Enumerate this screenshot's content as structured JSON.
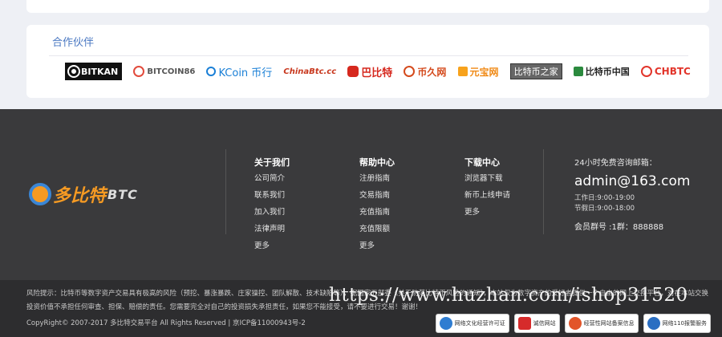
{
  "partners": {
    "title": "合作伙伴",
    "logos": [
      {
        "icon": "bitkan-logo-icon",
        "text": "BITKAN"
      },
      {
        "icon": "bitcoin86-logo-icon",
        "text": "BITCOIN86"
      },
      {
        "icon": "okcoin-logo-icon",
        "text": "KCoin 币行"
      },
      {
        "icon": "chinabtc-logo-icon",
        "text": "ChinaBtc.cc"
      },
      {
        "icon": "8btc-logo-icon",
        "text": "巴比特"
      },
      {
        "icon": "btcdo-logo-icon",
        "text": "币久网"
      },
      {
        "icon": "yuanbao-logo-icon",
        "text": "元宝网"
      },
      {
        "icon": "btczj-logo-icon",
        "text": "比特币之家"
      },
      {
        "icon": "btcchina-logo-icon",
        "text": "比特币中国"
      },
      {
        "icon": "chbtc-logo-icon",
        "text": "CHBTC"
      }
    ]
  },
  "footer": {
    "brand": {
      "name": "多比特",
      "suffix": "BTC"
    },
    "columns": [
      {
        "title": "关于我们",
        "links": [
          "公司简介",
          "联系我们",
          "加入我们",
          "法律声明",
          "更多"
        ]
      },
      {
        "title": "帮助中心",
        "links": [
          "注册指南",
          "交易指南",
          "充值指南",
          "充值限额",
          "更多"
        ]
      },
      {
        "title": "下载中心",
        "links": [
          "浏览器下载",
          "新币上线申请",
          "更多"
        ]
      }
    ],
    "contact": {
      "label": "24小时免费咨询邮箱：",
      "email": "admin@163.com",
      "workday": "工作日:9:00-19:00",
      "holiday": "节假日:9:00-18:00",
      "qq": "会员群号 :1群：888888"
    }
  },
  "bottom": {
    "risk_line1": "风险提示：比特币等数字资产交易具有极高的风险（预挖、暴涨暴跌、庄家操控、团队解散、技术缺陷等），据国家五部委《关于防范比特币风险的通知》，本站仅为数字资产的爱好者提供一个自由的网上交换平台，对在本站交换的数字资产的来源、价值，网站运营方不承担任何审查、担保、赔偿的责任",
    "risk_line2": "投资价值不承担任何审查、担保、赔偿的责任。您需要完全对自己的投资损失承担责任，如果您不能接受，请不要进行交易！谢谢！",
    "copyright": "CopyRight© 2007-2017 多比特交易平台 All Rights Reserved  |  京ICP备11000943号-2",
    "watermark": "https://www.huzhan.com/ishop31520",
    "badges": [
      "网络文化经营许可证",
      "诚信网站",
      "经营性网站备案信息",
      "网络110报警服务"
    ]
  }
}
